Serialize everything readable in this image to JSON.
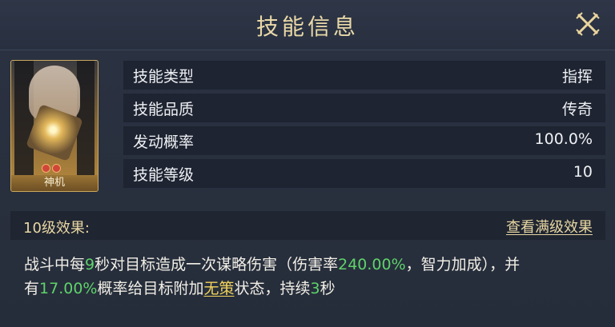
{
  "header": {
    "title": "技能信息"
  },
  "card": {
    "name": "神机"
  },
  "rows": [
    {
      "key": "技能类型",
      "value": "指挥"
    },
    {
      "key": "技能品质",
      "value": "传奇"
    },
    {
      "key": "发动概率",
      "value": "100.0%"
    },
    {
      "key": "技能等级",
      "value": "10"
    }
  ],
  "effect": {
    "title": "10级效果:",
    "link": "查看满级效果",
    "line1": {
      "a": "战斗中每",
      "b": "9",
      "c": "秒对目标造成一次谋略伤害（伤害率",
      "d": "240.00%",
      "e": "，智力加成），并"
    },
    "line2": {
      "a": "有",
      "b": "17.00%",
      "c": "概率给目标附加",
      "d": "无策",
      "e": "状态，持续",
      "f": "3",
      "g": "秒"
    }
  },
  "colors": {
    "accent_gold": "#e8d7a3",
    "highlight_green": "#5fd36a",
    "highlight_yellow": "#f2d35c"
  }
}
